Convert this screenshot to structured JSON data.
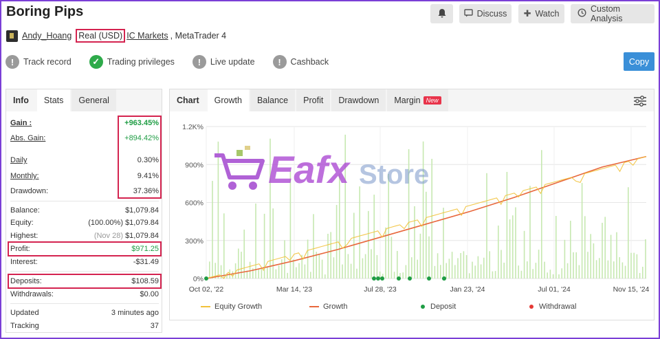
{
  "title": "Boring Pips",
  "header_buttons": {
    "discuss": "Discuss",
    "watch": "Watch",
    "custom_analysis": "Custom Analysis"
  },
  "account": {
    "user": "Andy_Hoang",
    "type": "Real (USD)",
    "broker": "IC Markets",
    "platform": ", MetaTrader 4"
  },
  "badges": [
    {
      "label": "Track record",
      "state": "unverified"
    },
    {
      "label": "Trading privileges",
      "state": "verified"
    },
    {
      "label": "Live update",
      "state": "unverified"
    },
    {
      "label": "Cashback",
      "state": "unverified"
    }
  ],
  "copy_label": "Copy",
  "left_tabs": [
    "Info",
    "Stats",
    "General"
  ],
  "stats": {
    "gain": {
      "label": "Gain :",
      "value": "+963.45%"
    },
    "abs_gain": {
      "label": "Abs. Gain:",
      "value": "+894.42%"
    },
    "daily": {
      "label": "Daily",
      "value": "0.30%"
    },
    "monthly": {
      "label": "Monthly:",
      "value": "9.41%"
    },
    "drawdown": {
      "label": "Drawdown:",
      "value": "37.36%"
    },
    "balance": {
      "label": "Balance:",
      "value": "$1,079.84"
    },
    "equity": {
      "label": "Equity:",
      "pct": "(100.00%)",
      "value": "$1,079.84"
    },
    "highest": {
      "label": "Highest:",
      "date": "(Nov 28)",
      "value": "$1,079.84"
    },
    "profit": {
      "label": "Profit:",
      "value": "$971.25"
    },
    "interest": {
      "label": "Interest:",
      "value": "-$31.49"
    },
    "deposits": {
      "label": "Deposits:",
      "value": "$108.59"
    },
    "withdrawals": {
      "label": "Withdrawals:",
      "value": "$0.00"
    },
    "updated": {
      "label": "Updated",
      "value": "3 minutes ago"
    },
    "tracking": {
      "label": "Tracking",
      "value": "37"
    }
  },
  "chart_tabs": [
    "Chart",
    "Growth",
    "Balance",
    "Profit",
    "Drawdown",
    "Margin"
  ],
  "new_badge": "New",
  "watermark": {
    "brand1": "Eafx",
    "brand2": "Store"
  },
  "colors": {
    "accent": "#3a8fd8",
    "green": "#1f9d44",
    "highlight": "#d4234f",
    "growth": "#e8673c",
    "equity": "#f2c23a",
    "bars": "#bfe3a8"
  },
  "chart_data": {
    "type": "line",
    "y_ticks": [
      "0%",
      "300%",
      "600%",
      "900%",
      "1.2K%"
    ],
    "x_ticks": [
      "Oct 02, '22",
      "Mar 14, '23",
      "Jul 28, '23",
      "Jan 23, '24",
      "Jul 01, '24",
      "Nov 15, '24"
    ],
    "ylim": [
      0,
      1200
    ],
    "series": [
      {
        "name": "Equity Growth",
        "values": [
          0,
          60,
          140,
          230,
          330,
          430,
          530,
          640,
          760,
          880,
          963
        ]
      },
      {
        "name": "Growth",
        "values": [
          0,
          60,
          140,
          230,
          330,
          430,
          530,
          640,
          760,
          880,
          963
        ]
      }
    ],
    "legend": [
      "Equity Growth",
      "Growth",
      "Deposit",
      "Withdrawal"
    ],
    "deposits_count": 9
  }
}
